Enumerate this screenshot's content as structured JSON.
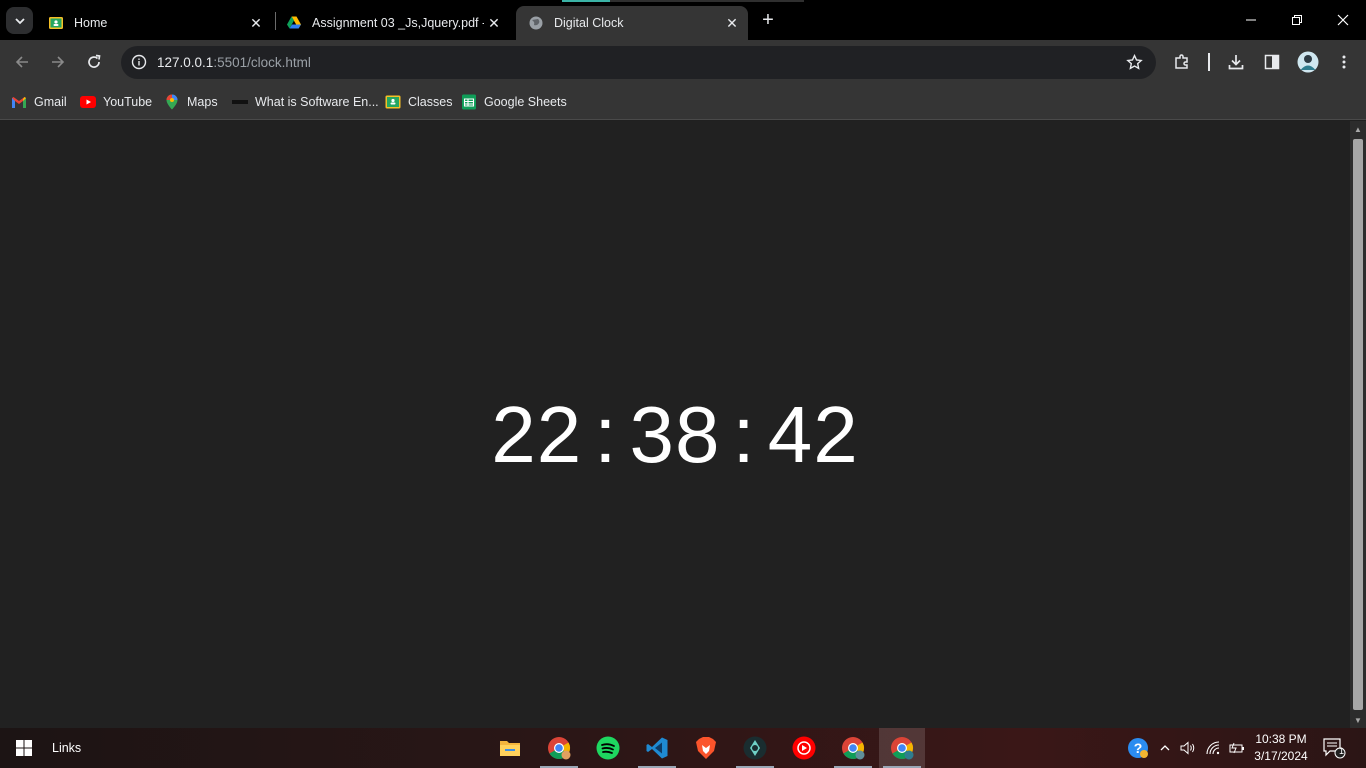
{
  "tabs": [
    {
      "title": "Home",
      "icon": "google-classroom-icon"
    },
    {
      "title": "Assignment 03 _Js,Jquery.pdf - G",
      "icon": "google-drive-icon"
    },
    {
      "title": "Digital Clock",
      "icon": "globe-icon",
      "active": true
    }
  ],
  "toolbar": {
    "url_host": "127.0.0.1",
    "url_path": ":5501/clock.html"
  },
  "bookmarks": [
    {
      "label": "Gmail",
      "icon": "gmail-icon"
    },
    {
      "label": "YouTube",
      "icon": "youtube-icon"
    },
    {
      "label": "Maps",
      "icon": "maps-icon"
    },
    {
      "label": "What is Software En...",
      "icon": "page-icon"
    },
    {
      "label": "Classes",
      "icon": "classroom-icon"
    },
    {
      "label": "Google Sheets",
      "icon": "sheets-icon"
    }
  ],
  "clock": {
    "hours": "22",
    "minutes": "38",
    "seconds": "42",
    "separator": ":"
  },
  "taskbar": {
    "links_label": "Links",
    "time": "10:38 PM",
    "date": "3/17/2024",
    "notification_count": "1"
  },
  "colors": {
    "page_background": "#212121",
    "clock_text": "#ffffff",
    "toolbar": "#353535",
    "tabstrip": "#000000"
  }
}
